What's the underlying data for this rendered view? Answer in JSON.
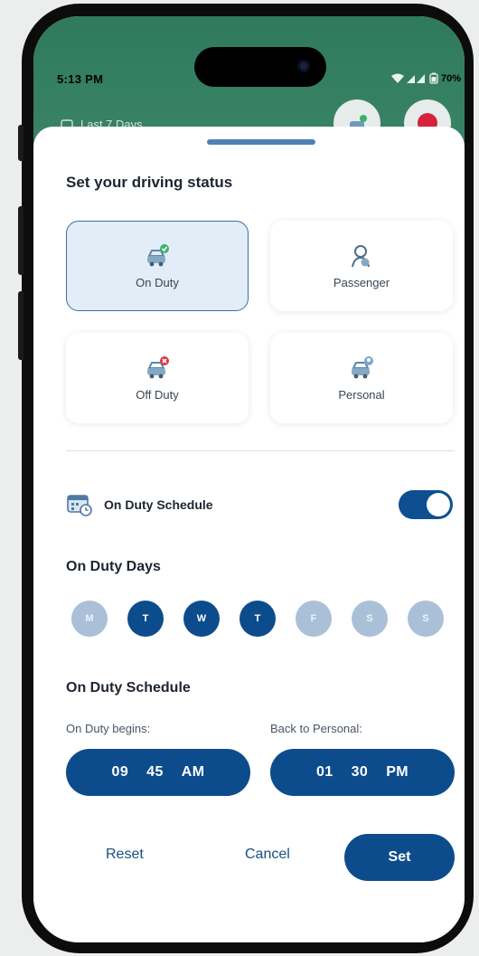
{
  "status_bar": {
    "time": "5:13 PM",
    "battery": "70%"
  },
  "behind": {
    "filter_label": "Last 7 Days"
  },
  "sheet": {
    "title": "Set your driving status",
    "statuses": [
      {
        "label": "On Duty",
        "icon": "car-check-icon",
        "selected": true
      },
      {
        "label": "Passenger",
        "icon": "passenger-icon",
        "selected": false
      },
      {
        "label": "Off Duty",
        "icon": "car-x-icon",
        "selected": false
      },
      {
        "label": "Personal",
        "icon": "car-personal-icon",
        "selected": false
      }
    ],
    "schedule_toggle": {
      "label": "On Duty Schedule",
      "enabled": true
    },
    "days_title": "On Duty Days",
    "days": [
      {
        "label": "M",
        "active": false
      },
      {
        "label": "T",
        "active": true
      },
      {
        "label": "W",
        "active": true
      },
      {
        "label": "T",
        "active": true
      },
      {
        "label": "F",
        "active": false
      },
      {
        "label": "S",
        "active": false
      },
      {
        "label": "S",
        "active": false
      }
    ],
    "schedule_title": "On Duty Schedule",
    "begins": {
      "label": "On Duty begins:",
      "hour": "09",
      "minute": "45",
      "period": "AM"
    },
    "back": {
      "label": "Back to Personal:",
      "hour": "01",
      "minute": "30",
      "period": "PM"
    },
    "actions": {
      "reset": "Reset",
      "cancel": "Cancel",
      "set": "Set"
    }
  },
  "colors": {
    "primary": "#0d4c8c",
    "header_green": "#2f7a5e",
    "inactive_day": "#a9c0d8",
    "selected_card": "#e2edf8"
  }
}
